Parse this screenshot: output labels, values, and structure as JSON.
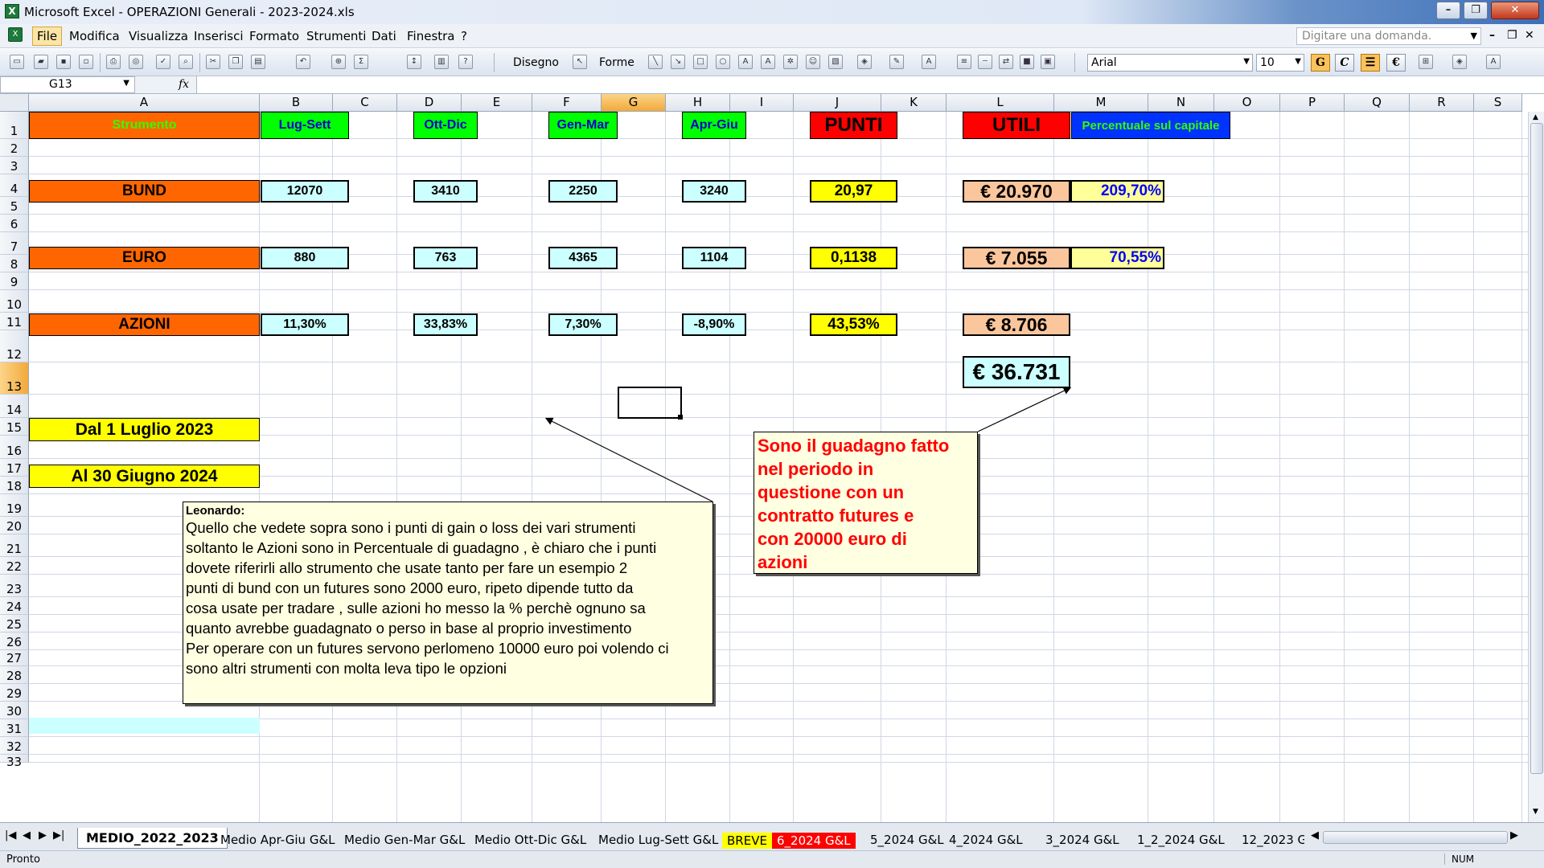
{
  "window": {
    "title": "Microsoft Excel - OPERAZIONI Generali - 2023-2024.xls",
    "app_icon_letter": "X"
  },
  "menu": {
    "items": [
      "File",
      "Modifica",
      "Visualizza",
      "Inserisci",
      "Formato",
      "Strumenti",
      "Dati",
      "Finestra",
      "?"
    ],
    "question_placeholder": "Digitare una domanda."
  },
  "toolbar": {
    "drawing_label": "Disegno",
    "shapes_label": "Forme",
    "font": "Arial",
    "size": "10",
    "bold_label": "G",
    "italic_label": "C",
    "euro_label": "€"
  },
  "formula_bar": {
    "name_box": "G13",
    "fx": "fx"
  },
  "columns": [
    "A",
    "B",
    "C",
    "D",
    "E",
    "F",
    "G",
    "H",
    "I",
    "J",
    "K",
    "L",
    "M",
    "N",
    "O",
    "P",
    "Q",
    "R",
    "S"
  ],
  "rows": [
    "1",
    "2",
    "3",
    "4",
    "5",
    "6",
    "7",
    "8",
    "9",
    "10",
    "11",
    "12",
    "13",
    "14",
    "15",
    "16",
    "17",
    "18",
    "19",
    "20",
    "21",
    "22",
    "23",
    "24",
    "25",
    "26",
    "27",
    "28",
    "29",
    "30",
    "31",
    "32",
    "33"
  ],
  "headers": {
    "strumento": "Strumento",
    "lug_sett": "Lug-Sett",
    "ott_dic": "Ott-Dic",
    "gen_mar": "Gen-Mar",
    "apr_giu": "Apr-Giu",
    "punti": "PUNTI",
    "utili": "UTILI",
    "percentuale": "Percentuale sul capitale"
  },
  "table": [
    {
      "name": "BUND",
      "lug_sett": "12070",
      "ott_dic": "3410",
      "gen_mar": "2250",
      "apr_giu": "3240",
      "punti": "20,97",
      "utili": "€ 20.970",
      "percent": "209,70%"
    },
    {
      "name": "EURO",
      "lug_sett": "880",
      "ott_dic": "763",
      "gen_mar": "4365",
      "apr_giu": "1104",
      "punti": "0,1138",
      "utili": "€ 7.055",
      "percent": "70,55%"
    },
    {
      "name": "AZIONI",
      "lug_sett": "11,30%",
      "ott_dic": "33,83%",
      "gen_mar": "7,30%",
      "apr_giu": "-8,90%",
      "punti": "43,53%",
      "utili": "€ 8.706",
      "percent": ""
    }
  ],
  "total": "€ 36.731",
  "dates": {
    "from": "Dal 1 Luglio  2023",
    "to": "Al 30 Giugno 2024"
  },
  "comments": {
    "leonardo_author": "Leonardo:",
    "leonardo_lines": [
      "Quello che vedete sopra sono i punti di gain o loss dei vari strumenti",
      "soltanto le Azioni sono in Percentuale di guadagno , è chiaro che i punti",
      "dovete riferirli allo strumento che usate tanto per fare un esempio 2",
      "punti di bund con un futures sono 2000 euro, ripeto dipende tutto da",
      "cosa usate per tradare , sulle azioni ho messo la % perchè ognuno sa",
      "quanto avrebbe guadagnato o perso in base al proprio investimento",
      "Per operare con un futures servono perlomeno 10000 euro poi volendo ci",
      "sono altri strumenti con molta leva tipo le opzioni"
    ],
    "red_lines": [
      "Sono il guadagno fatto",
      "nel periodo in",
      "questione con un",
      "contratto futures e",
      "con 20000 euro di",
      "azioni"
    ]
  },
  "sheet_tabs": [
    "MEDIO_2022_2023",
    "Medio Apr-Giu G&L",
    "Medio Gen-Mar G&L",
    "Medio Ott-Dic G&L",
    "Medio Lug-Sett G&L",
    "BREVE",
    "6_2024 G&L",
    "5_2024 G&L",
    "4_2024 G&L",
    "3_2024 G&L",
    "1_2_2024 G&L",
    "12_2023 G"
  ],
  "status": {
    "left": "Pronto",
    "right": "NUM"
  },
  "colors": {
    "orange": "#ff6600",
    "green": "#00ff00",
    "cyan": "#ccffff",
    "yellow": "#ffff00",
    "red": "#ff0000",
    "peach": "#fcc69c",
    "blue": "#0033ff",
    "note": "#ffffe1"
  }
}
